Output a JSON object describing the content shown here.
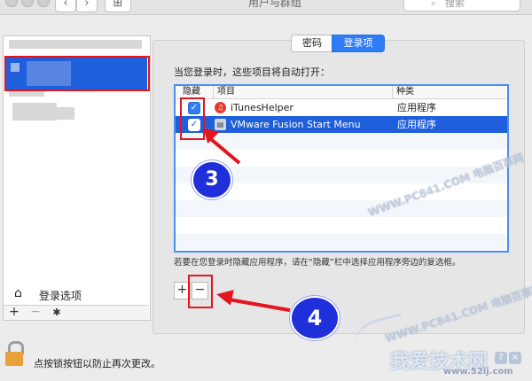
{
  "window": {
    "title": "用户与群组",
    "search_placeholder": "搜索",
    "back_glyph": "‹",
    "forward_glyph": "›",
    "grid_glyph": "⊞"
  },
  "sidebar": {
    "login_options_label": "登录选项",
    "toolbar": {
      "add": "+",
      "remove": "−",
      "gear": "✱"
    }
  },
  "tabs": [
    {
      "label": "密码",
      "selected": false
    },
    {
      "label": "登录项",
      "selected": true
    }
  ],
  "intro_text": "当您登录时，这些项目将自动打开：",
  "table": {
    "headers": {
      "hide": "隐藏",
      "item": "项目",
      "kind": "种类"
    },
    "rows": [
      {
        "checked": true,
        "name": "iTunesHelper",
        "kind": "应用程序",
        "icon": "itunes-icon",
        "selected": false
      },
      {
        "checked": true,
        "name": "VMware Fusion Start Menu",
        "kind": "应用程序",
        "icon": "vmware-icon",
        "selected": true
      }
    ]
  },
  "hint_text": "若要在您登录时隐藏应用程序，请在“隐藏”栏中选择应用程序旁边的复选框。",
  "list_buttons": {
    "add": "+",
    "remove": "−"
  },
  "annotations": {
    "step3": "3",
    "step4": "4"
  },
  "lock_text": "点按锁按钮以防止再次更改。",
  "watermarks": {
    "wm1": "WWW.PC841.COM 电脑百事网",
    "wm2": "WWW.PC841.COM 电脑百事网",
    "wm3": "我爱技术网",
    "wm4": "www.52ij.com"
  },
  "colors": {
    "accent": "#2f7df6",
    "selection": "#1f5fdc",
    "annotation_red": "#e4151f",
    "badge_blue": "#1f2fd9"
  }
}
